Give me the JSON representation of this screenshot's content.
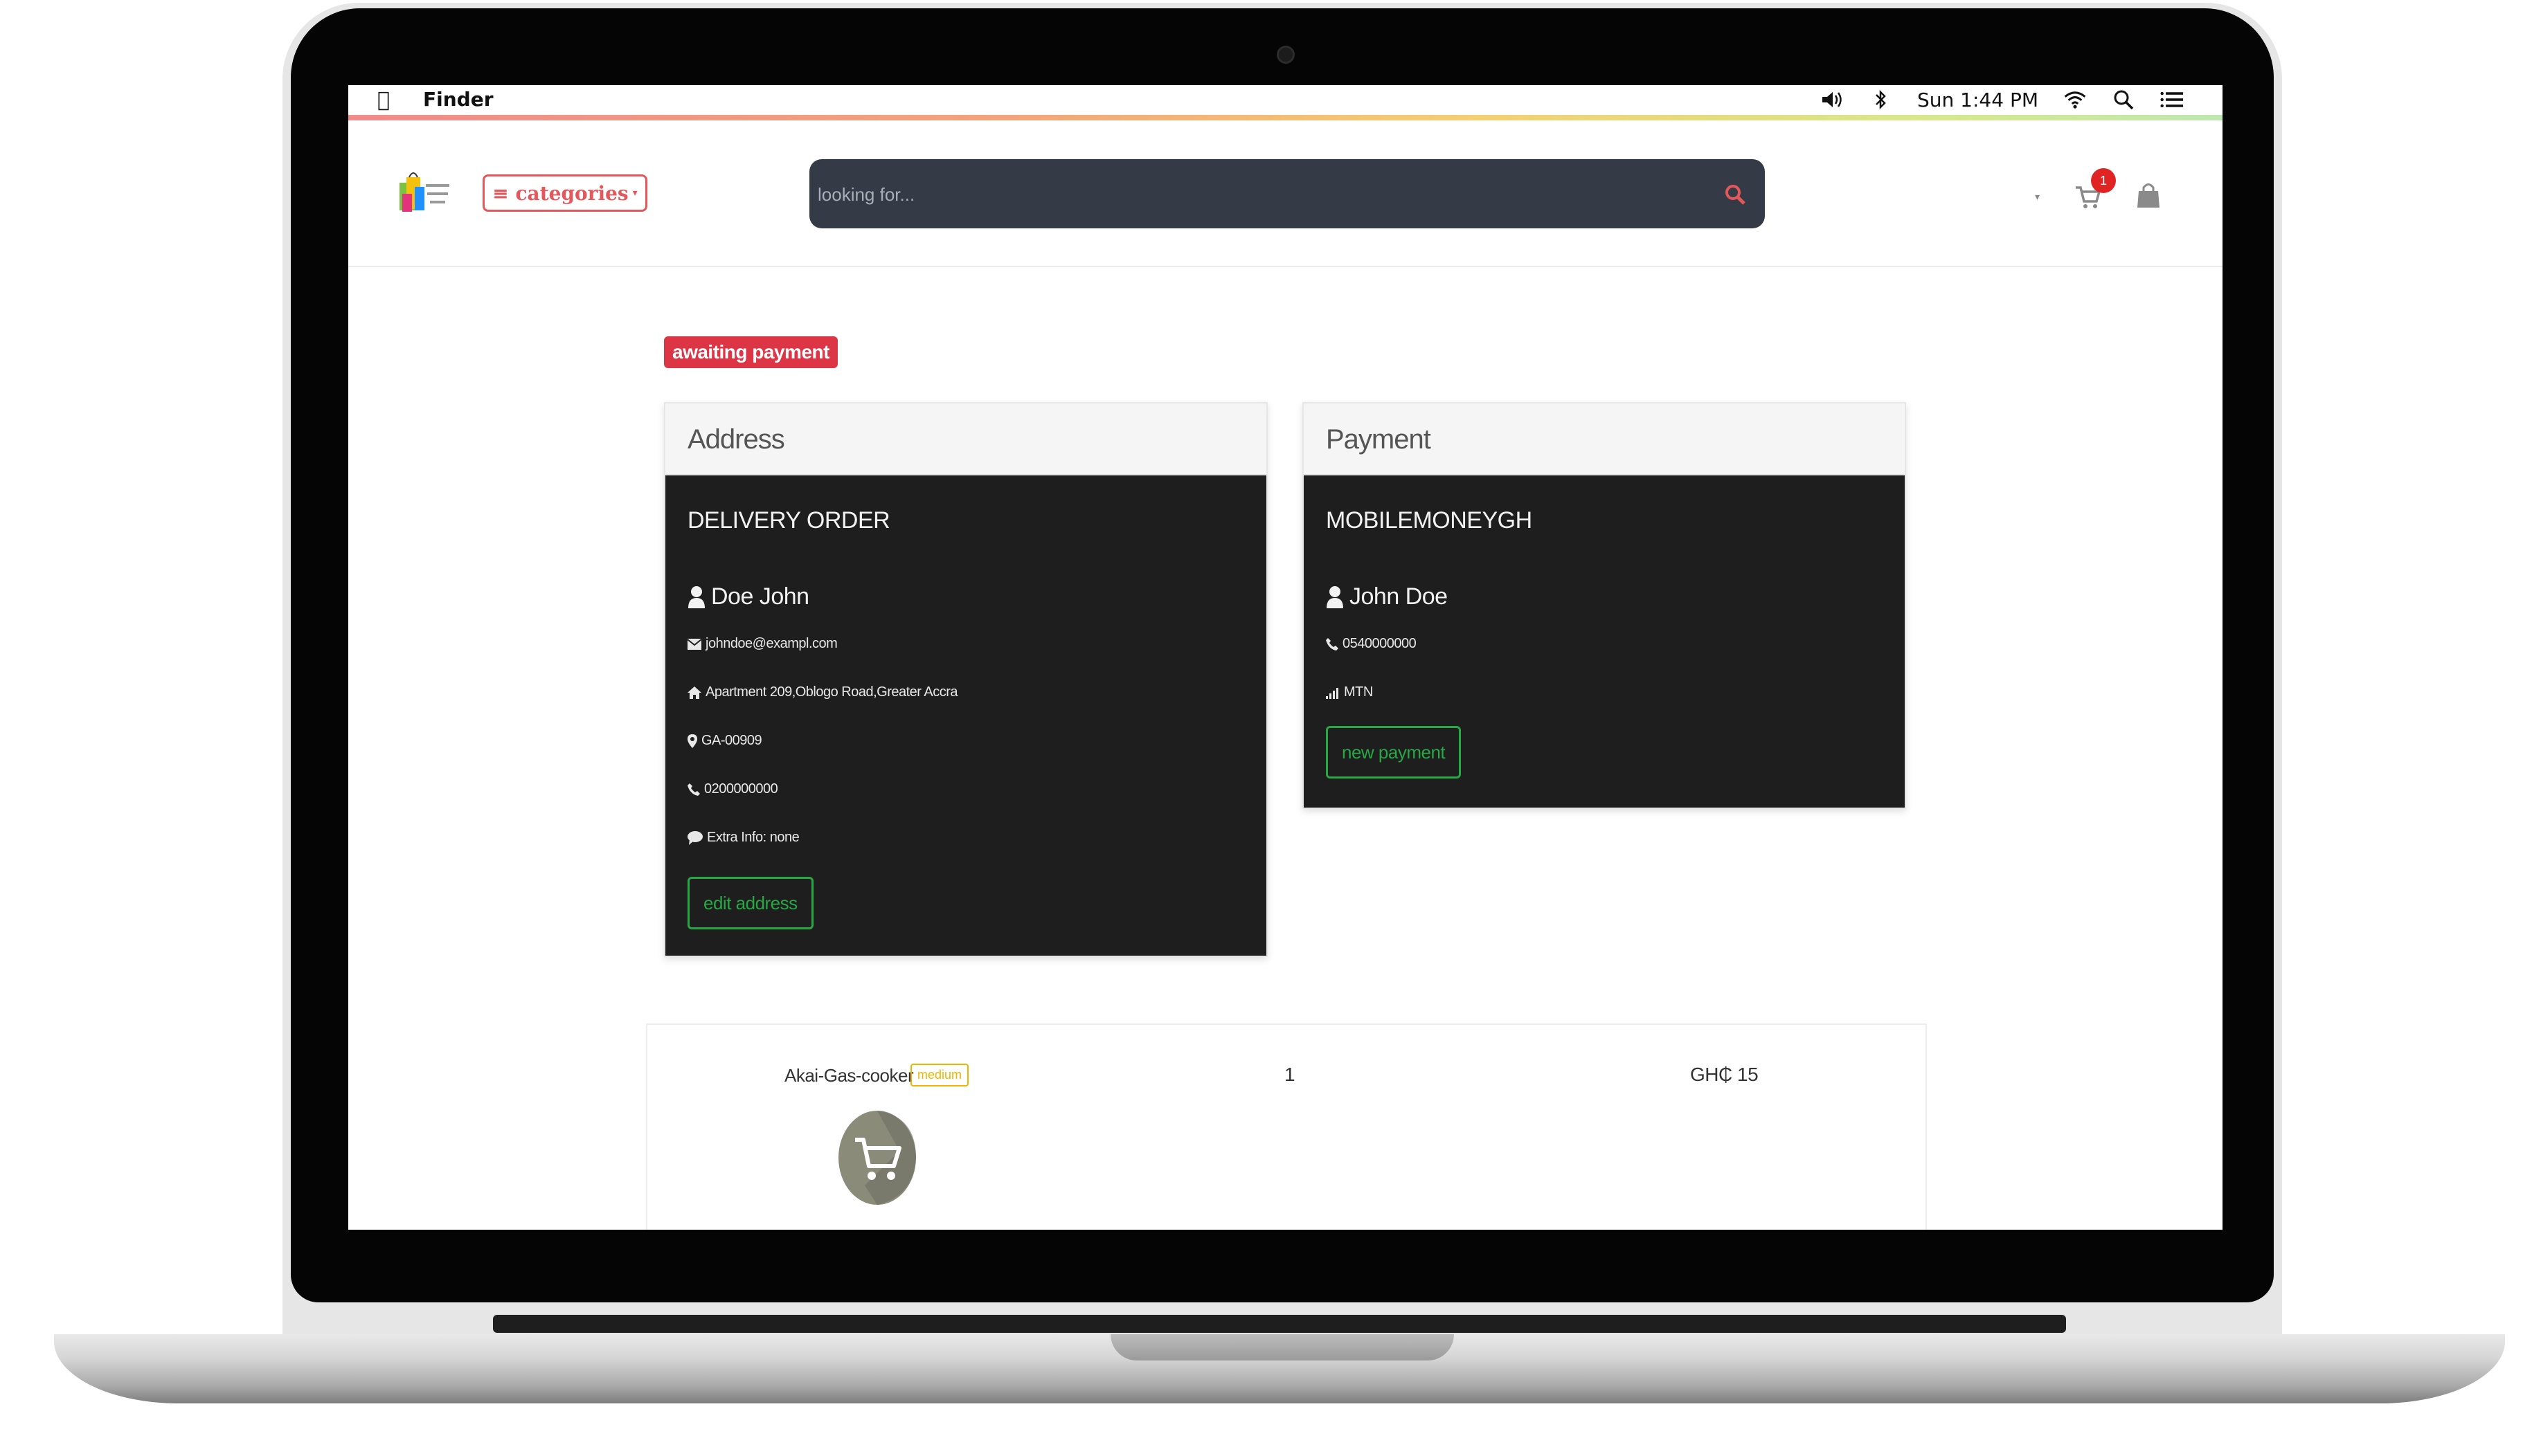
{
  "menubar": {
    "app_name": "Finder",
    "clock": "Sun 1:44 PM"
  },
  "navbar": {
    "categories_label": "≡ categories",
    "search_placeholder": "looking for...",
    "cart_count": "1"
  },
  "order_status": "awaiting payment",
  "address_card": {
    "header": "Address",
    "title": "DELIVERY ORDER",
    "name": "Doe John",
    "email": "johndoe@exampl.com",
    "street": "Apartment 209,Oblogo Road,Greater Accra",
    "postal_code": "GA-00909",
    "phone": "0200000000",
    "extra_info": "Extra Info: none",
    "button_label": "edit address"
  },
  "payment_card": {
    "header": "Payment",
    "title": "MOBILEMONEYGH",
    "name": "John Doe",
    "phone": "0540000000",
    "network": "MTN",
    "button_label": "new payment"
  },
  "order_items": [
    {
      "name": "Akai-Gas-cooker",
      "size": "medium",
      "quantity": "1",
      "price": "GH₵ 15"
    }
  ],
  "colors": {
    "accent_red": "#dc3545",
    "accent_green": "#28a745",
    "search_bg": "#343a46",
    "size_tag": "#f0b400"
  }
}
